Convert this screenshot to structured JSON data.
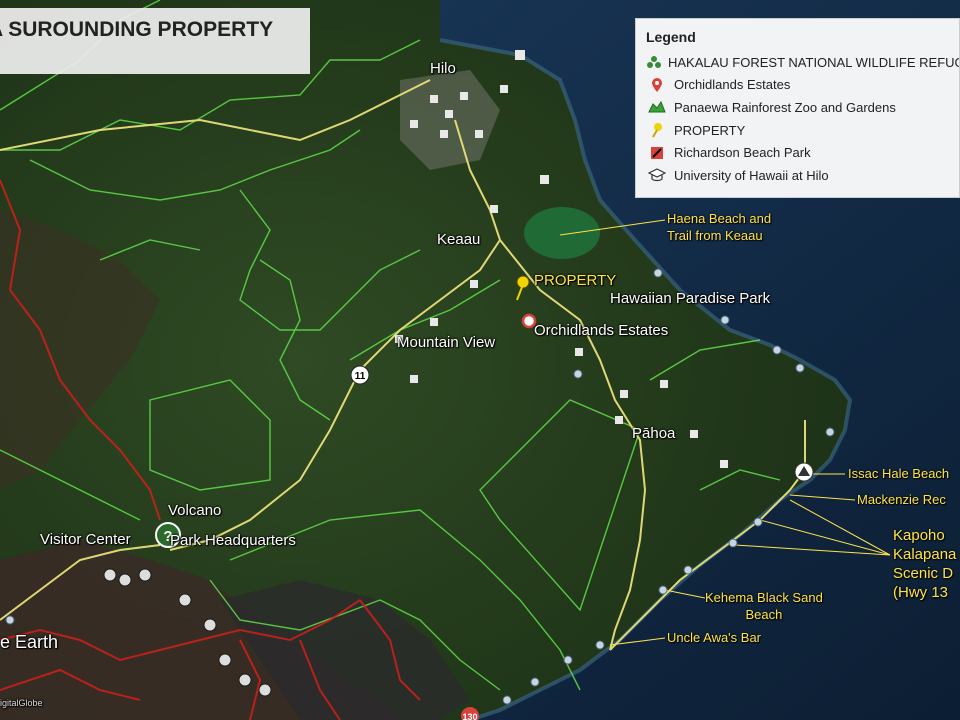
{
  "title": "A SUROUNDING PROPERTY",
  "legend": {
    "title": "Legend",
    "items": [
      {
        "label": "HAKALAU FOREST NATIONAL WILDLIFE REFUGE",
        "icon": "recycle-cluster-icon",
        "color": "#3a8a3a"
      },
      {
        "label": "Orchidlands Estates",
        "icon": "map-pin-icon",
        "color": "#d9413b"
      },
      {
        "label": "Panaewa Rainforest Zoo and Gardens",
        "icon": "zoo-icon",
        "color": "#3aa13a"
      },
      {
        "label": "PROPERTY",
        "icon": "pushpin-icon",
        "color": "#f0d400"
      },
      {
        "label": "Richardson Beach Park",
        "icon": "beach-flag-icon",
        "color": "#d9413b"
      },
      {
        "label": "University of Hawaii at Hilo",
        "icon": "graduation-cap-icon",
        "color": "#333333"
      }
    ]
  },
  "places": {
    "hilo": "Hilo",
    "keaau": "Keaau",
    "property": "PROPERTY",
    "hawaiian_paradise_park": "Hawaiian Paradise Park",
    "orchidlands": "Orchidlands Estates",
    "mountain_view": "Mountain View",
    "pahoa": "Pāhoa",
    "volcano": "Volcano",
    "visitor_center": "Visitor Center",
    "park_hq": "Park Headquarters",
    "earth": "e Earth"
  },
  "annotations": {
    "haena": [
      "Haena Beach and",
      "Trail from Keaau"
    ],
    "issac_hale": "Issac Hale Beach",
    "mackenzie": "Mackenzie Rec",
    "kapoho": [
      "Kapoho",
      "Kalapana",
      "Scenic D",
      "(Hwy 13"
    ],
    "kehema": [
      "Kehema Black Sand",
      "Beach"
    ],
    "uncle_awa": "Uncle Awa's Bar"
  },
  "road_shields": {
    "hwy11": "11",
    "hwy130": "130"
  },
  "attribution": "igitalGlobe",
  "colors": {
    "land_dark": "#1c3618",
    "land_mid": "#2d4a22",
    "ocean": "#10263e",
    "boundary_green": "#5fe04a",
    "boundary_red": "#c8201a",
    "road_yellow": "#e9e07a",
    "accent_yellow": "#ffe34d"
  }
}
